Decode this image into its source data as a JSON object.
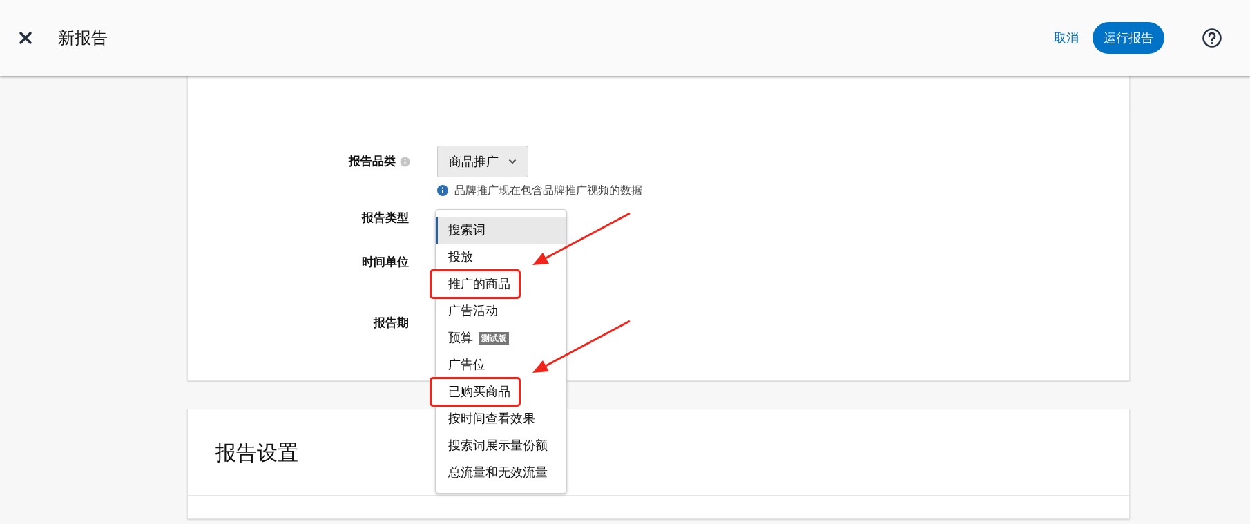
{
  "header": {
    "title": "新报告",
    "cancel": "取消",
    "run_button": "运行报告"
  },
  "config_card": {
    "category": {
      "label": "报告品类",
      "value": "商品推广",
      "note": "品牌推广现在包含品牌推广视频的数据"
    },
    "fields": [
      {
        "label": "报告类型"
      },
      {
        "label": "时间单位"
      },
      {
        "label": "报告期"
      }
    ],
    "report_type_menu": [
      {
        "label": "搜索词",
        "selected": true,
        "annotated": false
      },
      {
        "label": "投放",
        "selected": false,
        "annotated": false
      },
      {
        "label": "推广的商品",
        "selected": false,
        "annotated": true
      },
      {
        "label": "广告活动",
        "selected": false,
        "annotated": false
      },
      {
        "label": "预算",
        "badge": "测试版",
        "selected": false,
        "annotated": false
      },
      {
        "label": "广告位",
        "selected": false,
        "annotated": false
      },
      {
        "label": "已购买商品",
        "selected": false,
        "annotated": true
      },
      {
        "label": "按时间查看效果",
        "selected": false,
        "annotated": false
      },
      {
        "label": "搜索词展示量份额",
        "selected": false,
        "annotated": false
      },
      {
        "label": "总流量和无效流量",
        "selected": false,
        "annotated": false
      }
    ]
  },
  "settings_card": {
    "title": "报告设置"
  }
}
